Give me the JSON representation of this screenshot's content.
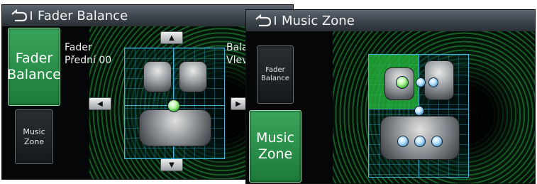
{
  "left": {
    "title": "Fader Balance",
    "side_buttons": [
      {
        "label": "Fader\nBalance",
        "active": true
      },
      {
        "label": "Music\nZone",
        "active": false
      }
    ],
    "fader_info": "Fader\nPřední 00",
    "balance_info": "Bala\nVlev",
    "arrows": {
      "up": "▲",
      "down": "▼",
      "left": "◀",
      "right": "▶"
    }
  },
  "right": {
    "title": "Music Zone",
    "side_buttons": [
      {
        "label": "Fader\nBalance",
        "active": false
      },
      {
        "label": "Music\nZone",
        "active": true
      }
    ]
  },
  "colors": {
    "accent_green": "#2e9a4a",
    "grid_cyan": "#3fb5d8",
    "title_bg": "#464e56"
  },
  "icons": {
    "back": "back-arrow-icon"
  }
}
